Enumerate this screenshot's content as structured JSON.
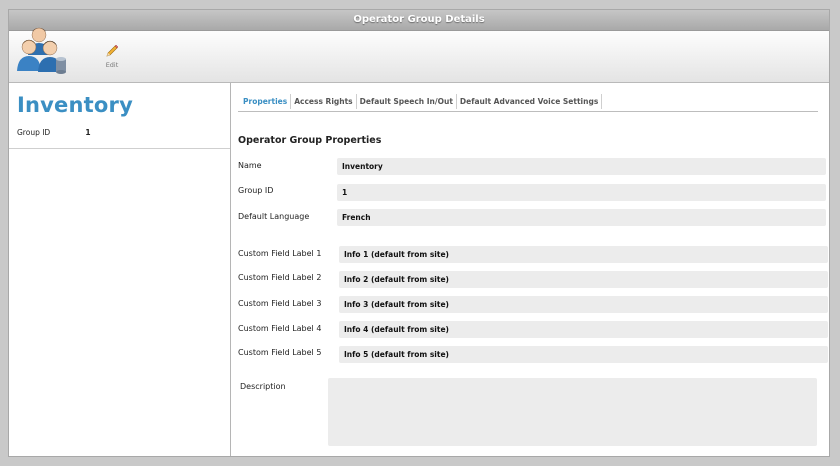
{
  "window": {
    "title": "Operator Group Details"
  },
  "toolbar": {
    "group_icon": "operator-group-icon",
    "edit": {
      "label": "Edit",
      "icon": "pencil-icon"
    }
  },
  "sidebar": {
    "title": "Inventory",
    "group_id_label": "Group ID",
    "group_id_value": "1"
  },
  "tabs": [
    "Properties",
    "Access Rights",
    "Default Speech In/Out",
    "Default Advanced Voice Settings"
  ],
  "properties": {
    "section_title": "Operator Group Properties",
    "name": {
      "label": "Name",
      "value": "Inventory"
    },
    "group_id": {
      "label": "Group ID",
      "value": "1"
    },
    "default_language": {
      "label": "Default Language",
      "value": "French"
    },
    "custom_fields": [
      {
        "label": "Custom Field Label 1",
        "value": "Info 1 (default from site)"
      },
      {
        "label": "Custom Field Label 2",
        "value": "Info 2 (default from site)"
      },
      {
        "label": "Custom Field Label 3",
        "value": "Info 3 (default from site)"
      },
      {
        "label": "Custom Field Label 4",
        "value": "Info 4 (default from site)"
      },
      {
        "label": "Custom Field Label 5",
        "value": "Info 5 (default from site)"
      }
    ],
    "description": {
      "label": "Description",
      "value": ""
    }
  },
  "colors": {
    "accent": "#3b8fc3",
    "field_bg": "#ececec",
    "title_bar": "#b3b3b3"
  }
}
